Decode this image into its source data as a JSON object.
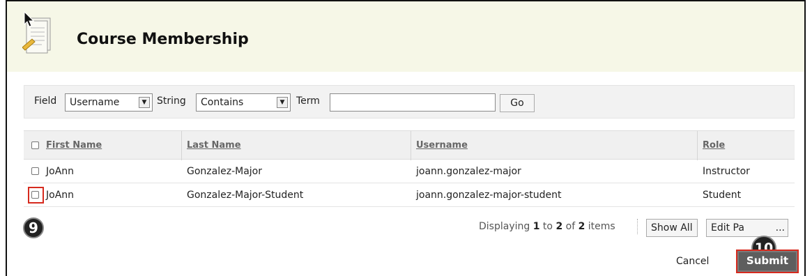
{
  "page": {
    "title": "Course Membership"
  },
  "search": {
    "field_label": "Field",
    "field_value": "Username",
    "string_label": "String",
    "string_value": "Contains",
    "term_label": "Term",
    "term_value": "",
    "go_label": "Go"
  },
  "table": {
    "columns": [
      "First Name",
      "Last Name",
      "Username",
      "Role"
    ],
    "rows": [
      {
        "first": "JoAnn",
        "last": "Gonzalez-Major",
        "username": "joann.gonzalez-major",
        "role": "Instructor"
      },
      {
        "first": "JoAnn",
        "last": "Gonzalez-Major-Student",
        "username": "joann.gonzalez-major-student",
        "role": "Student"
      }
    ]
  },
  "pagination": {
    "prefix": "Displaying ",
    "from": "1",
    "mid": " to ",
    "to": "2",
    "of": " of ",
    "total": "2",
    "suffix": " items",
    "show_all": "Show All",
    "edit_paging": "Edit Pa",
    "ellipsis": "..."
  },
  "steps": {
    "step9": "9",
    "step10": "10"
  },
  "actions": {
    "cancel": "Cancel",
    "submit": "Submit"
  },
  "colors": {
    "highlight": "#d62a1e",
    "header_bg": "#f6f7e7"
  }
}
